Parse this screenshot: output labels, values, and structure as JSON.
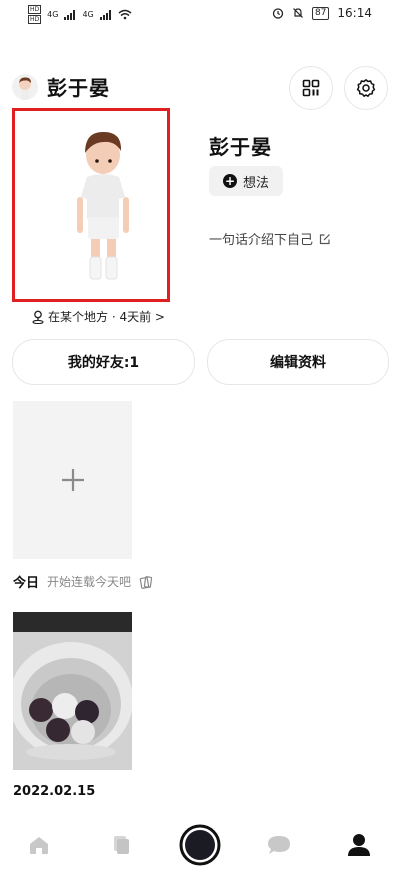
{
  "status_bar": {
    "sim1": "HD",
    "sim2": "HD",
    "net1": "4G",
    "net2": "4G",
    "battery": "87",
    "time": "16:14"
  },
  "header": {
    "title": "彭于晏",
    "qr_icon": "qr-code-icon",
    "settings_icon": "gear-icon"
  },
  "profile": {
    "name": "彭于晏",
    "idea_chip": "想法",
    "intro": "一句话介绍下自己",
    "location": "在某个地方 · 4天前 >"
  },
  "buttons": {
    "friends": "我的好友:1",
    "edit": "编辑资料"
  },
  "today": {
    "label": "今日",
    "hint": "开始连载今天吧"
  },
  "post": {
    "date": "2022.02.15"
  },
  "tabbar": {
    "items": [
      "home-icon",
      "copy-icon",
      "camera-icon",
      "chat-icon",
      "profile-icon"
    ]
  },
  "colors": {
    "highlight_border": "#e02020",
    "tile_bg": "#f3f3f3",
    "text_main": "#111111",
    "text_muted": "#888888"
  }
}
